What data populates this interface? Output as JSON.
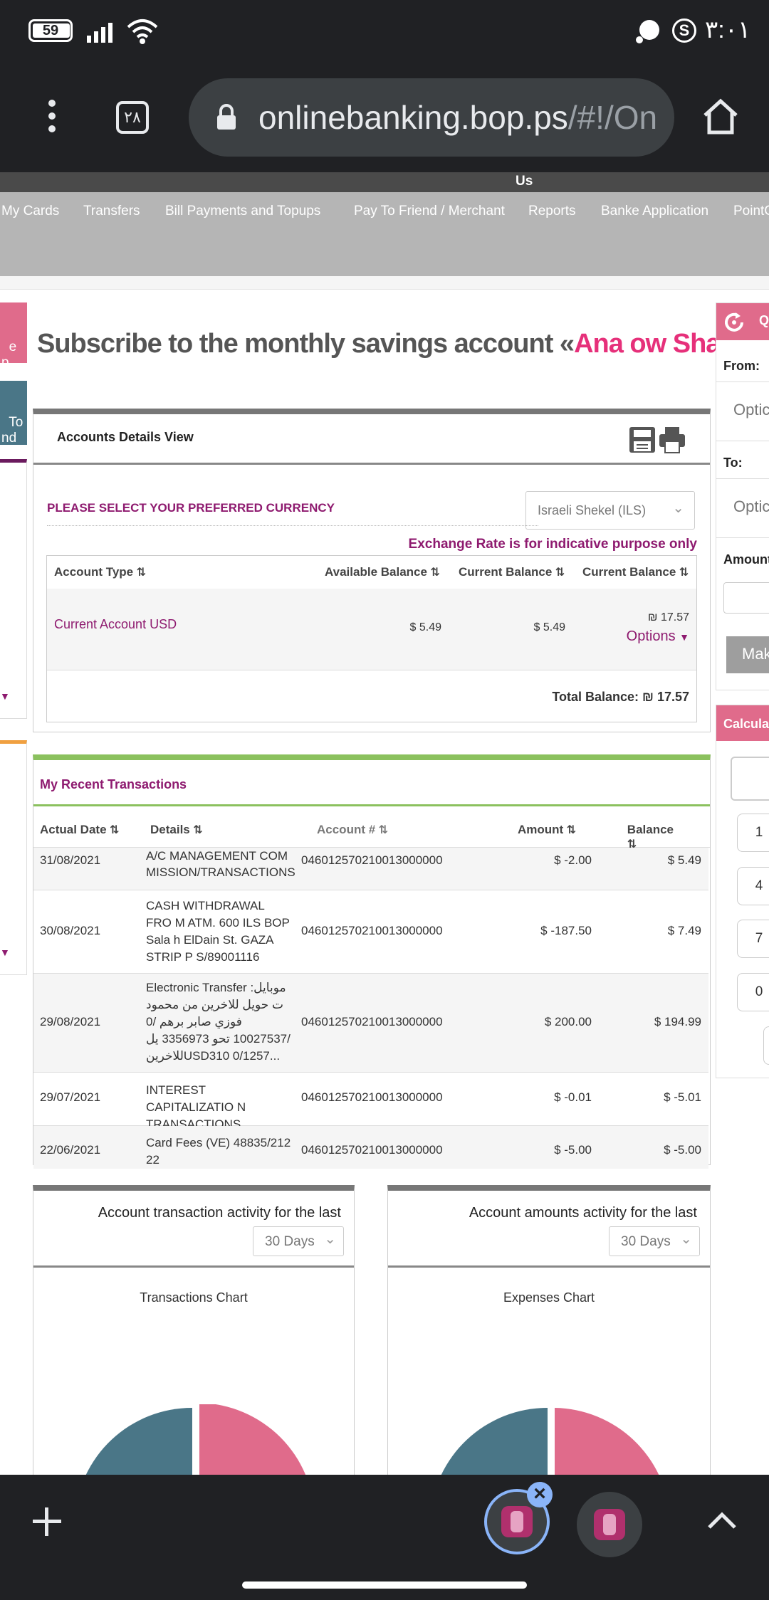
{
  "status_bar": {
    "battery": "59",
    "time": "٣:٠١"
  },
  "browser": {
    "tab_count": "٢٨",
    "url_host": "onlinebanking.bop.ps",
    "url_path": "/#!/Onli"
  },
  "nav": {
    "top_label": "Us",
    "items": [
      "My Cards",
      "Transfers",
      "Bill Payments and Topups",
      "Pay To Friend / Merchant",
      "Reports",
      "Banke Application",
      "PointC"
    ]
  },
  "left_side": {
    "tab1": "e\np",
    "tab2": "To\nnd"
  },
  "banner": {
    "prefix": "Subscribe to the monthly savings account «",
    "highlight": "Ana ow Shatarti",
    "suffix": "» ",
    "arrow": ">"
  },
  "accounts": {
    "title": "Accounts Details View",
    "currency_prompt": "PLEASE SELECT YOUR PREFERRED CURRENCY",
    "currency_selected": "Israeli Shekel (ILS)",
    "exchange_note": "Exchange Rate is for indicative purpose only",
    "columns": [
      "Account Type",
      "Available Balance",
      "Current Balance",
      "Current Balance"
    ],
    "row": {
      "account": "Current Account USD",
      "available": "$ 5.49",
      "current": "$ 5.49",
      "converted": "₪ 17.57",
      "options": "Options"
    },
    "total": "Total Balance: ₪ 17.57"
  },
  "transactions": {
    "title": "My Recent Transactions",
    "columns": [
      "Actual Date",
      "Details",
      "Account #",
      "Amount",
      "Balance"
    ],
    "rows": [
      {
        "date": "31/08/2021",
        "details": "A/C MANAGEMENT COM MISSION/TRANSACTIONS",
        "account": "046012570210013000000",
        "amount": "$ -2.00",
        "balance": "$ 5.49"
      },
      {
        "date": "30/08/2021",
        "details": "CASH WITHDRAWAL FRO M ATM. 600 ILS BOP Sala h ElDain St. GAZA STRIP P S/89001116",
        "account": "046012570210013000000",
        "amount": "$ -187.50",
        "balance": "$ 7.49"
      },
      {
        "date": "29/08/2021",
        "details": "Electronic Transfer موبايل: ت حويل للاخرين من محمود فوزي صابر برهم /0 /10027537 تحو 3356973 يل للاخرينUSD310 0/1257...",
        "account": "046012570210013000000",
        "amount": "$ 200.00",
        "balance": "$ 194.99"
      },
      {
        "date": "29/07/2021",
        "details": "INTEREST CAPITALIZATIO N TRANSACTIONS",
        "account": "046012570210013000000",
        "amount": "$ -0.01",
        "balance": "$ -5.01"
      },
      {
        "date": "22/06/2021",
        "details": "Card Fees (VE) 48835/212 22",
        "account": "046012570210013000000",
        "amount": "$ -5.00",
        "balance": "$ -5.00"
      }
    ]
  },
  "widgets": [
    {
      "title": "Account transaction activity for the last",
      "period": "30 Days",
      "chart_title": "Transactions Chart"
    },
    {
      "title": "Account amounts activity for the last",
      "period": "30 Days",
      "chart_title": "Expenses Chart"
    }
  ],
  "right_panel": {
    "header": "Q",
    "from_label": "From:",
    "from_placeholder": "Optic",
    "to_label": "To:",
    "to_placeholder": "Optic",
    "amount_label": "Amount",
    "make_button": "Mak",
    "calc_header": "Calculat",
    "keys": [
      "1",
      "4",
      "7",
      "0"
    ]
  },
  "colors": {
    "accent_purple": "#8e1a6f",
    "pink": "#e06b8b",
    "teal": "#4a7687",
    "green_bar": "#8bc15e"
  }
}
